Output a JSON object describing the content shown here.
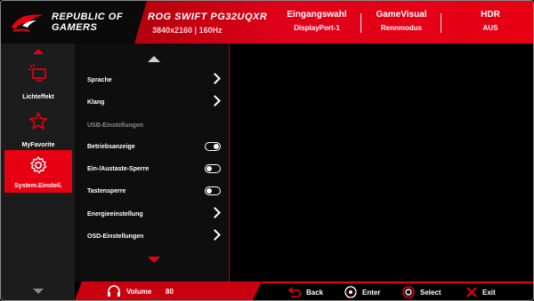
{
  "header": {
    "brand_line1": "REPUBLIC OF",
    "brand_line2": "GAMERS",
    "model": "ROG SWIFT PG32UQXR",
    "resolution": "3840x2160 | 160Hz",
    "status": [
      {
        "title": "Eingangswahl",
        "value": "DisplayPort-1"
      },
      {
        "title": "GameVisual",
        "value": "Rennmodus"
      },
      {
        "title": "HDR",
        "value": "AUS"
      }
    ]
  },
  "sidebar": {
    "items": [
      {
        "label": "Lichteffekt",
        "icon": "light-effect-icon"
      },
      {
        "label": "MyFavorite",
        "icon": "star-icon"
      },
      {
        "label": "System.Einstell.",
        "icon": "gear-icon"
      }
    ]
  },
  "menu": {
    "rows": [
      {
        "label": "Sprache",
        "control": "chevron"
      },
      {
        "label": "Klang",
        "control": "chevron"
      },
      {
        "label": "USB-Einstellungen",
        "control": "none",
        "disabled": true
      },
      {
        "label": "Betriebsanzeige",
        "control": "toggle-on"
      },
      {
        "label": "Ein-/Austaste-Sperre",
        "control": "toggle-off"
      },
      {
        "label": "Tastensperre",
        "control": "toggle-off"
      },
      {
        "label": "Energieeinstellung",
        "control": "chevron"
      },
      {
        "label": "OSD-Einstellungen",
        "control": "chevron"
      }
    ]
  },
  "footer": {
    "volume_label": "Volume",
    "volume_value": "80",
    "keys": [
      {
        "label": "Back",
        "icon": "back-arrow-icon"
      },
      {
        "label": "Enter",
        "icon": "joystick-enter-icon"
      },
      {
        "label": "Select",
        "icon": "joystick-select-icon"
      },
      {
        "label": "Exit",
        "icon": "close-icon"
      }
    ]
  },
  "colors": {
    "accent": "#e60012",
    "panel": "#1c1c1c"
  }
}
